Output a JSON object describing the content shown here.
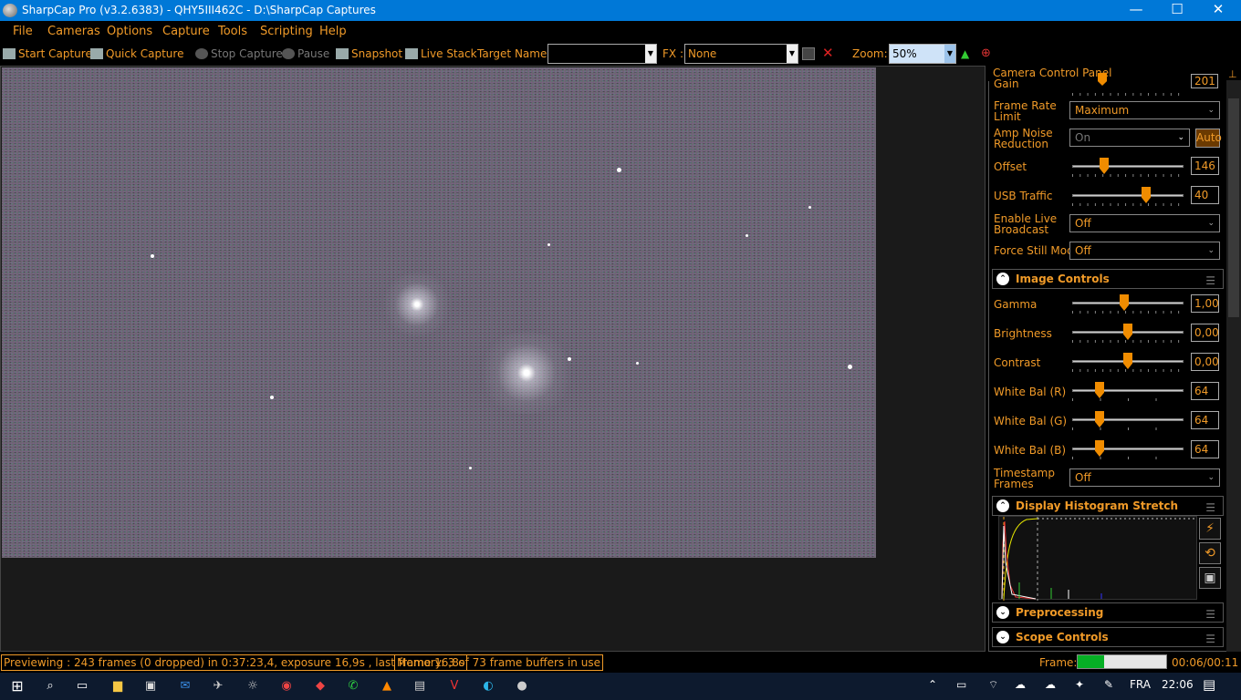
{
  "window": {
    "title": "SharpCap Pro (v3.2.6383) - QHY5III462C - D:\\SharpCap Captures",
    "minimize": "—",
    "maximize": "☐",
    "close": "✕"
  },
  "menu": [
    "File",
    "Cameras",
    "Options",
    "Capture",
    "Tools",
    "Scripting",
    "Help"
  ],
  "toolbar": {
    "start_capture": "Start Capture",
    "quick_capture": "Quick Capture",
    "stop_capture": "Stop Capture",
    "pause": "Pause",
    "snapshot": "Snapshot",
    "live_stack": "Live Stack",
    "target_name_label": "Target Name :",
    "target_name_value": "",
    "fx_label": "FX :",
    "fx_value": "None",
    "zoom_label": "Zoom:",
    "zoom_value": "50%"
  },
  "camera_panel": {
    "title": "Camera Control Panel",
    "gain_label": "Gain",
    "gain_value": "201",
    "frame_rate_label": "Frame Rate Limit",
    "frame_rate_value": "Maximum",
    "amp_noise_label": "Amp Noise Reduction",
    "amp_noise_value": "On",
    "amp_noise_auto": "Auto",
    "offset_label": "Offset",
    "offset_value": "146",
    "usb_label": "USB Traffic",
    "usb_value": "40",
    "broadcast_label": "Enable Live Broadcast",
    "broadcast_value": "Off",
    "force_still_label": "Force Still Mode",
    "force_still_value": "Off"
  },
  "image_controls": {
    "title": "Image Controls",
    "gamma_label": "Gamma",
    "gamma_value": "1,00",
    "brightness_label": "Brightness",
    "brightness_value": "0,00",
    "contrast_label": "Contrast",
    "contrast_value": "0,00",
    "wbr_label": "White Bal (R)",
    "wbr_value": "64",
    "wbg_label": "White Bal (G)",
    "wbg_value": "64",
    "wbb_label": "White Bal (B)",
    "wbb_value": "64",
    "timestamp_label": "Timestamp Frames",
    "timestamp_value": "Off"
  },
  "sections": {
    "histogram": "Display Histogram Stretch",
    "preprocessing": "Preprocessing",
    "scope": "Scope Controls"
  },
  "status": {
    "preview": "Previewing : 243 frames (0 dropped) in 0:37:23,4, exposure 16,9s , last frame 16,8s",
    "memory": "Memory: 3 of 73 frame buffers in use",
    "frame_label": "Frame:",
    "frame_progress": 0.3,
    "frame_time": "00:06/00:11"
  },
  "taskbar": {
    "language": "FRA",
    "time": "22:06"
  },
  "colors": {
    "accent": "#f09a28",
    "titlebar": "#0078d7",
    "progress": "#06b025"
  }
}
